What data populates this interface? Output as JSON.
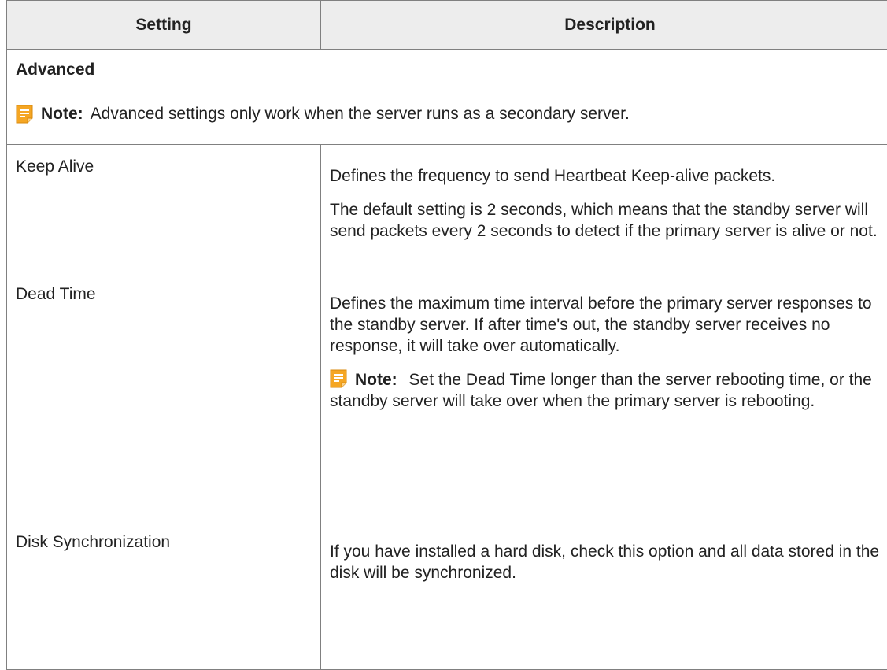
{
  "table": {
    "headers": {
      "setting": "Setting",
      "description": "Description"
    },
    "section": {
      "title": "Advanced",
      "note_label": "Note:",
      "note_text": "Advanced settings only work when the server runs as a secondary server."
    },
    "rows": [
      {
        "setting": "Keep Alive",
        "paragraphs": [
          "Defines the frequency to send Heartbeat Keep-alive packets.",
          "The default setting is 2 seconds, which means that the standby server will send packets every 2 seconds to detect if the primary server is alive or not."
        ]
      },
      {
        "setting": "Dead Time",
        "paragraphs": [
          "Defines the maximum time interval before the primary server responses to the standby server. If after time's out, the standby server receives no response, it will take over automatically."
        ],
        "note_label": "Note:",
        "note_text": "Set the Dead Time longer than the server rebooting time, or the standby server will take over when the primary server is rebooting."
      },
      {
        "setting": "Disk Synchronization",
        "paragraphs": [
          "If you have installed a hard disk, check this option and all data stored in the disk will be synchronized."
        ]
      }
    ]
  },
  "icons": {
    "note": "note-icon",
    "note_color": "#f5a623"
  }
}
